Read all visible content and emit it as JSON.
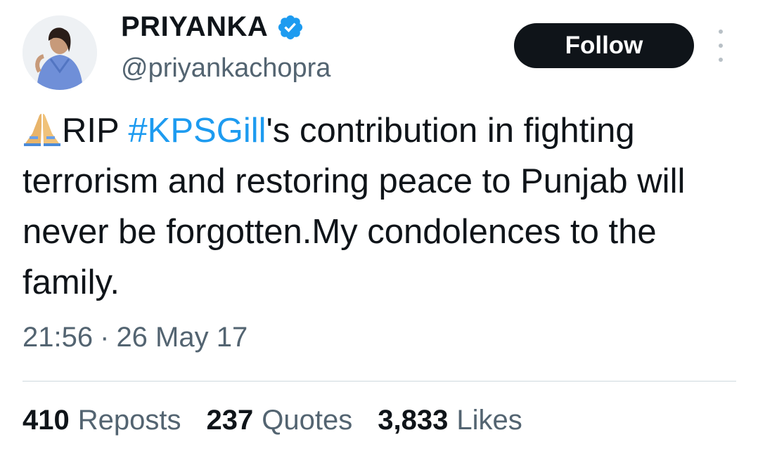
{
  "author": {
    "display_name": "PRIYANKA",
    "handle": "@priyankachopra",
    "verified_icon": "verified-badge-icon",
    "verified_color": "#1d9bf0"
  },
  "follow_label": "Follow",
  "tweet": {
    "emoji": "🙏",
    "text_before": "RIP ",
    "hashtag": "#KPSGill",
    "text_after": "'s contribution in fighting terrorism and restoring peace to Punjab will never be forgotten.My condolences to the family."
  },
  "timestamp": {
    "time": "21:56",
    "separator": "·",
    "date": "26 May 17"
  },
  "stats": {
    "reposts": {
      "count": "410",
      "label": "Reposts"
    },
    "quotes": {
      "count": "237",
      "label": "Quotes"
    },
    "likes": {
      "count": "3,833",
      "label": "Likes"
    }
  },
  "colors": {
    "text": "#0f1419",
    "secondary": "#536471",
    "link": "#1d9bf0",
    "button_bg": "#0f1419"
  }
}
